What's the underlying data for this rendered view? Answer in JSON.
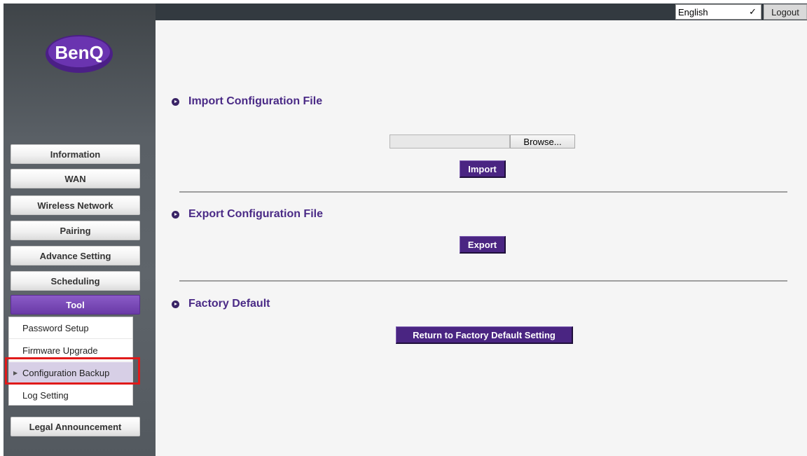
{
  "header": {
    "language": "English",
    "logout_label": "Logout"
  },
  "brand": {
    "logo_text": "BenQ"
  },
  "sidebar": {
    "items": [
      {
        "label": "Information"
      },
      {
        "label": "WAN"
      },
      {
        "label": "Wireless Network"
      },
      {
        "label": "Pairing"
      },
      {
        "label": "Advance Setting"
      },
      {
        "label": "Scheduling"
      },
      {
        "label": "Tool"
      },
      {
        "label": "Legal Announcement"
      }
    ],
    "active": "Tool",
    "tool_submenu": [
      {
        "label": "Password Setup"
      },
      {
        "label": "Firmware Upgrade"
      },
      {
        "label": "Configuration Backup"
      },
      {
        "label": "Log Setting"
      }
    ],
    "active_submenu": "Configuration Backup"
  },
  "main": {
    "import": {
      "title": "Import Configuration File",
      "browse_label": "Browse...",
      "file_value": "",
      "import_label": "Import"
    },
    "export": {
      "title": "Export Configuration File",
      "export_label": "Export"
    },
    "factory": {
      "title": "Factory Default",
      "reset_label": "Return to Factory Default Setting"
    }
  },
  "colors": {
    "accent": "#4a2582",
    "title": "#4a2a86",
    "highlight": "#e01a1a"
  }
}
